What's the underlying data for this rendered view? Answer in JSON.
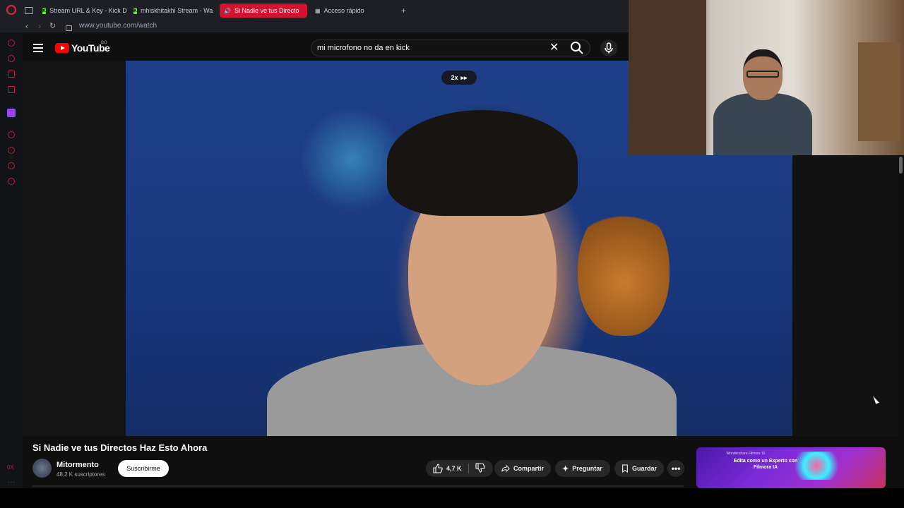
{
  "browser": {
    "tabs": [
      {
        "label": "Stream URL & Key - Kick D",
        "icon": "kick-icon"
      },
      {
        "label": "mhiskhitakhi Stream - Wa",
        "icon": "kick-icon"
      },
      {
        "label": "Si Nadie ve tus Directo",
        "icon": "speaker-icon",
        "active": true
      },
      {
        "label": "Acceso rápido",
        "icon": "grid-icon"
      }
    ],
    "url": "www.youtube.com/watch"
  },
  "youtube": {
    "logo_text": "YouTube",
    "country_code": "BO",
    "search_value": "mi microfono no da en kick"
  },
  "player": {
    "speed_label": "2x"
  },
  "video": {
    "title": "Si Nadie ve tus Directos Haz Esto Ahora",
    "channel": "Mitormento",
    "subscribers": "48,2 K suscriptores",
    "subscribe_label": "Suscribirme",
    "likes": "4,7 K",
    "share_label": "Compartir",
    "ask_label": "Preguntar",
    "save_label": "Guardar"
  },
  "ad": {
    "small_text": "Wondershare Filmora 15",
    "headline": "Edita como un Experto con Filmora IA"
  },
  "sidebar": {
    "speed_text": "0X"
  },
  "colors": {
    "accent": "#ff0000",
    "opera": "#e0263b",
    "background": "#0f0f0f"
  }
}
